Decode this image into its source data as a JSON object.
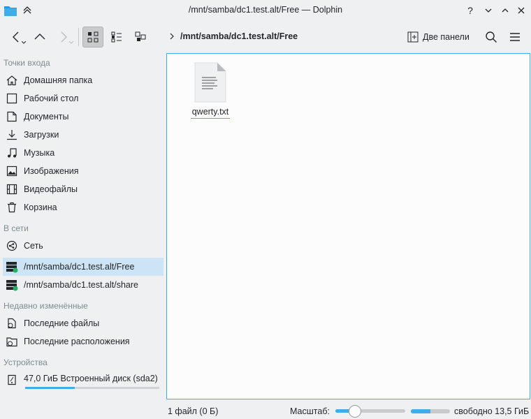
{
  "window": {
    "title": "/mnt/samba/dc1.test.alt/Free — Dolphin",
    "app_icon": "folder-icon",
    "buttons": [
      "help-icon",
      "minimize-icon",
      "maximize-icon",
      "close-icon"
    ]
  },
  "toolbar": {
    "breadcrumb": "/mnt/samba/dc1.test.alt/Free",
    "dual_panel_label": "Две панели",
    "view_mode_selected": "icons"
  },
  "sidebar": {
    "sections": [
      {
        "title": "Точки входа",
        "items": [
          {
            "label": "Домашняя папка",
            "icon": "home-icon"
          },
          {
            "label": "Рабочий стол",
            "icon": "desktop-icon"
          },
          {
            "label": "Документы",
            "icon": "documents-icon"
          },
          {
            "label": "Загрузки",
            "icon": "download-icon"
          },
          {
            "label": "Музыка",
            "icon": "music-icon"
          },
          {
            "label": "Изображения",
            "icon": "pictures-icon"
          },
          {
            "label": "Видеофайлы",
            "icon": "video-icon"
          },
          {
            "label": "Корзина",
            "icon": "trash-icon"
          }
        ]
      },
      {
        "title": "В сети",
        "items": [
          {
            "label": "Сеть",
            "icon": "network-icon"
          },
          {
            "label": "/mnt/samba/dc1.test.alt/Free",
            "icon": "network-share-icon",
            "selected": true
          },
          {
            "label": "/mnt/samba/dc1.test.alt/share",
            "icon": "network-share-icon"
          }
        ]
      },
      {
        "title": "Недавно изменённые",
        "items": [
          {
            "label": "Последние файлы",
            "icon": "recent-files-icon"
          },
          {
            "label": "Последние расположения",
            "icon": "recent-locations-icon"
          }
        ]
      },
      {
        "title": "Устройства",
        "items": [
          {
            "label": "47,0 ГиБ Встроенный диск (sda2)",
            "icon": "harddisk-icon",
            "usage_fraction": 0.37
          }
        ]
      }
    ]
  },
  "content": {
    "files": [
      {
        "name": "qwerty.txt",
        "icon": "text-file-icon"
      }
    ]
  },
  "statusbar": {
    "summary": "1 файл (0 Б)",
    "zoom_label": "Масштаб:",
    "zoom_fraction": 0.28,
    "free_space": "свободно 13,5 ГиБ",
    "used_fraction": 0.5
  }
}
